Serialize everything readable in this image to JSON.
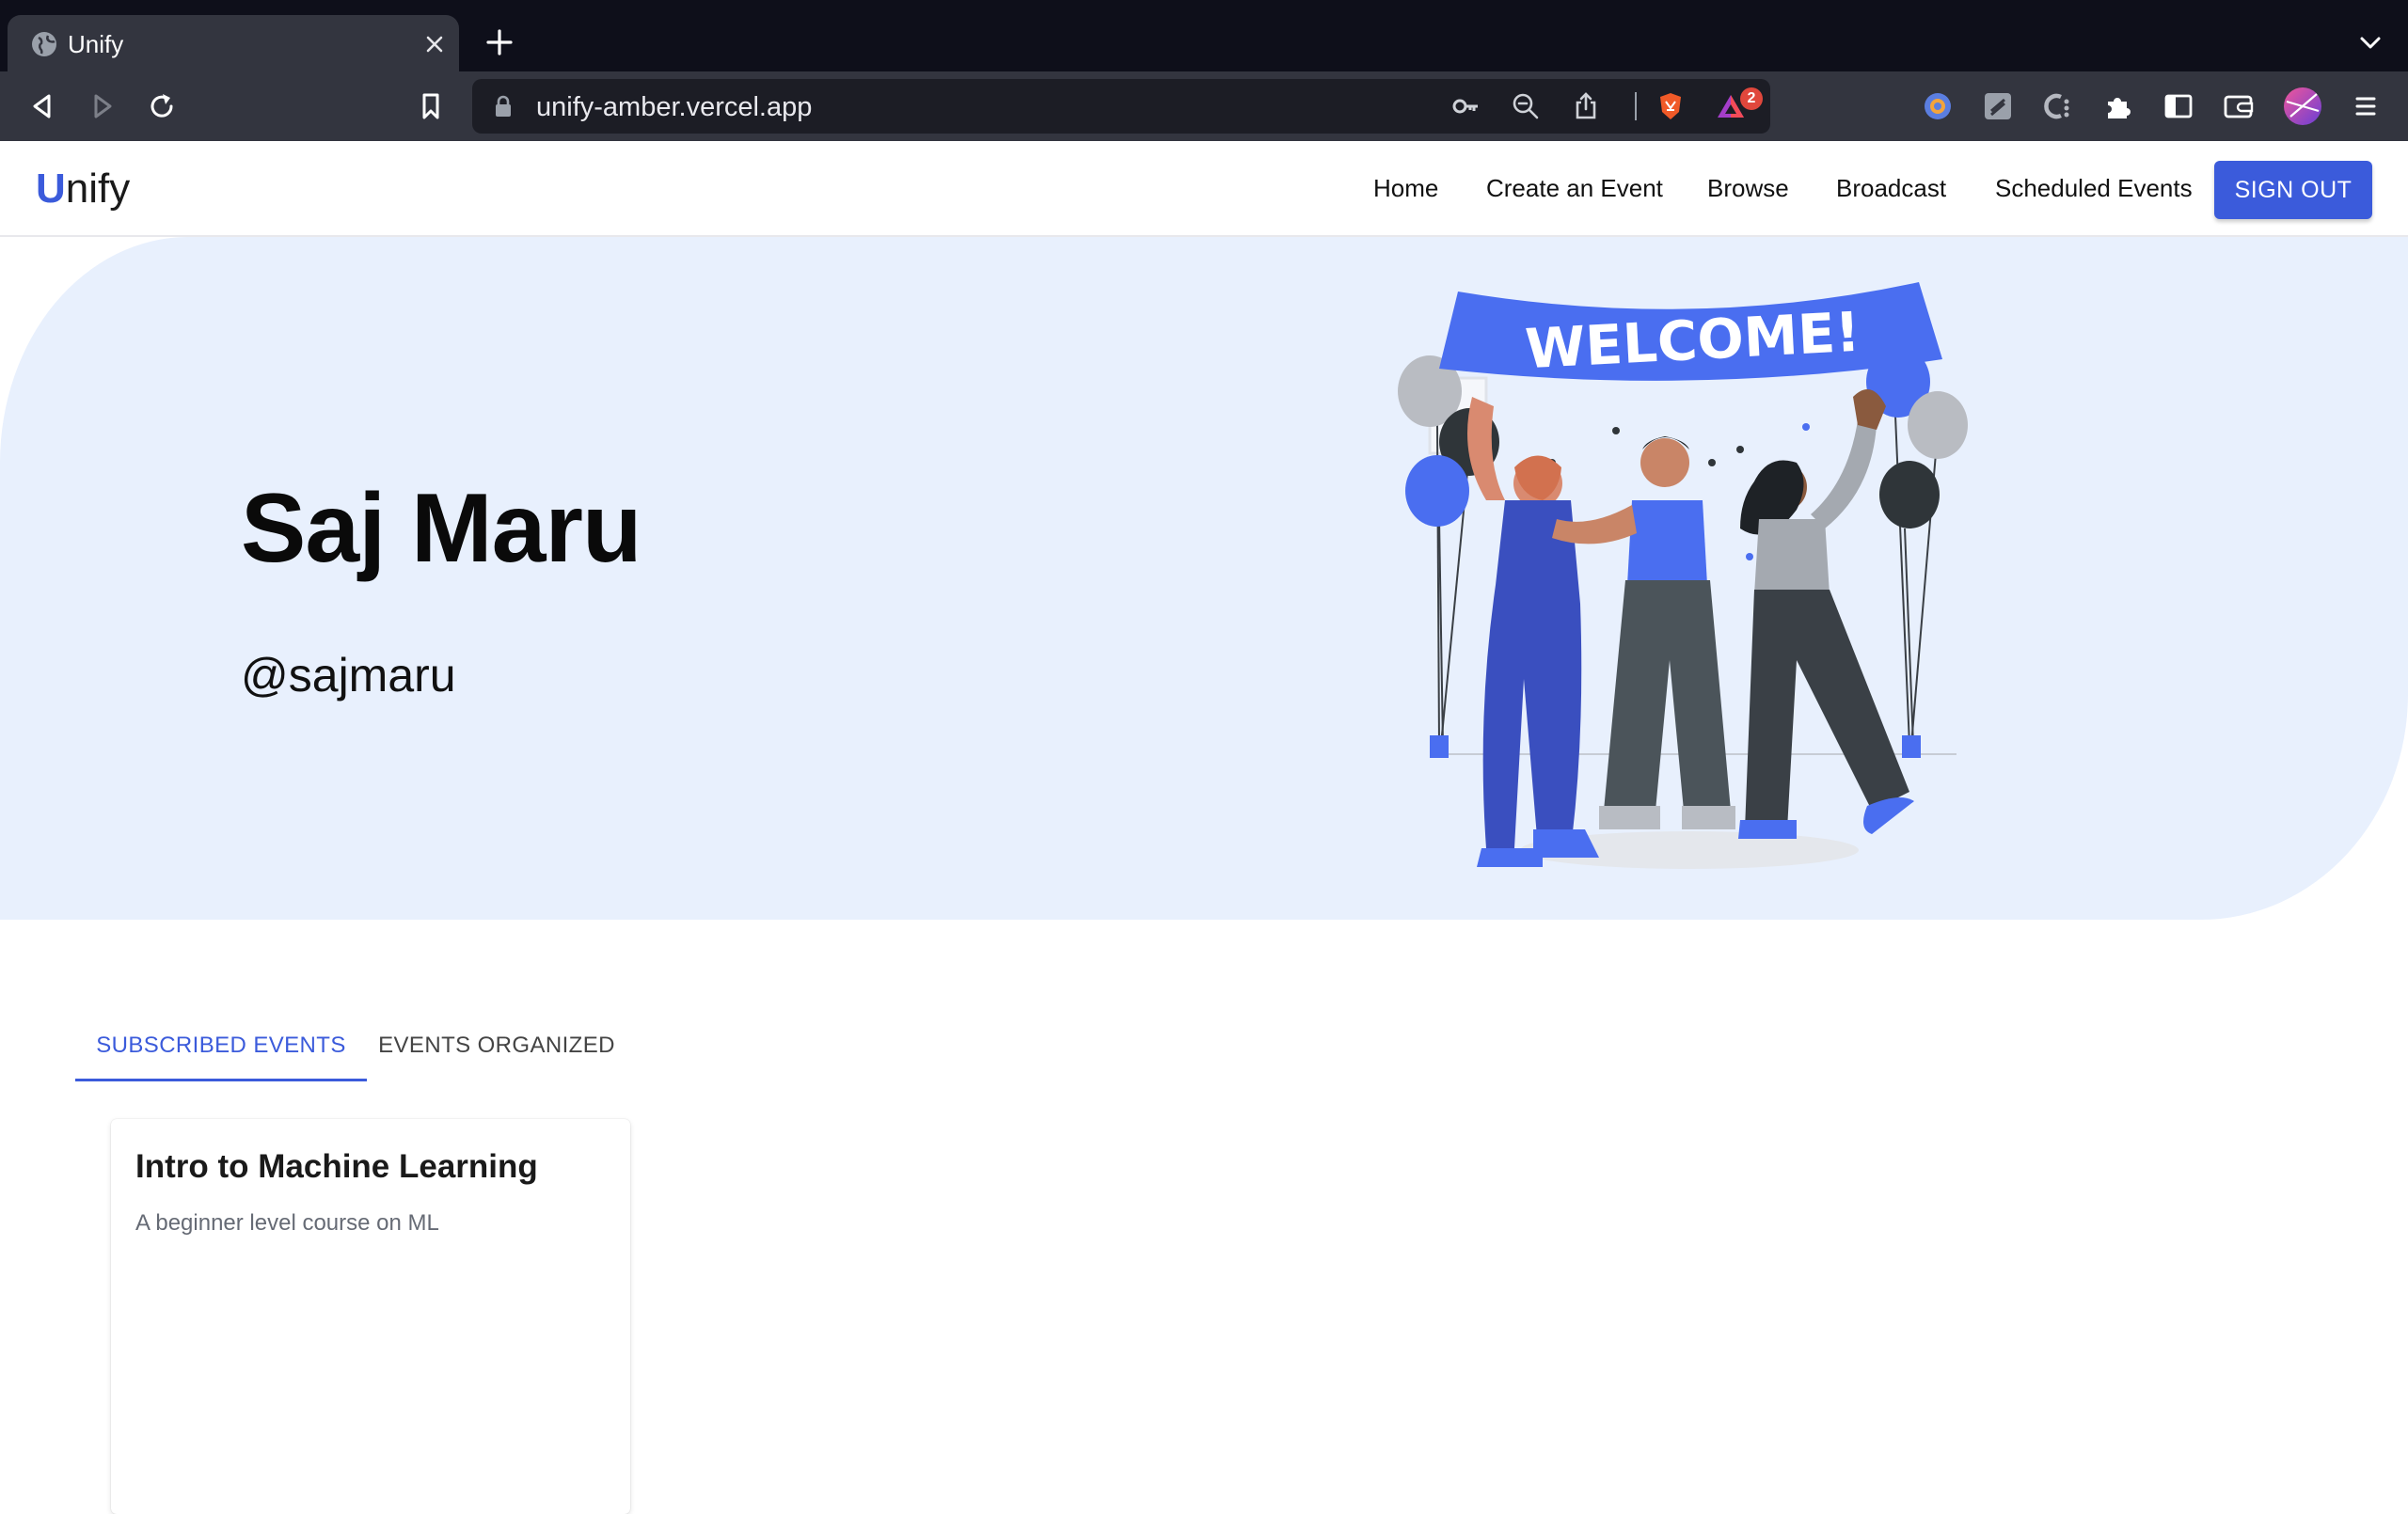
{
  "browser": {
    "tab_title": "Unify",
    "url": "unify-amber.vercel.app",
    "shields_badge": "2"
  },
  "nav": {
    "logo_first": "U",
    "logo_rest": "nify",
    "links": [
      "Home",
      "Create an Event",
      "Browse",
      "Broadcast",
      "Scheduled Events"
    ],
    "sign_out": "SIGN OUT"
  },
  "profile": {
    "name": "Saj Maru",
    "handle": "@sajmaru",
    "banner_text": "WELCOME!"
  },
  "tabs": {
    "subscribed": "SUBSCRIBED EVENTS",
    "organized": "EVENTS ORGANIZED",
    "active": "subscribed"
  },
  "events": [
    {
      "title": "Intro to Machine Learning",
      "description": "A beginner level course on ML"
    }
  ],
  "colors": {
    "accent": "#3b5bdb",
    "hero_bg": "#e8f0fd"
  }
}
